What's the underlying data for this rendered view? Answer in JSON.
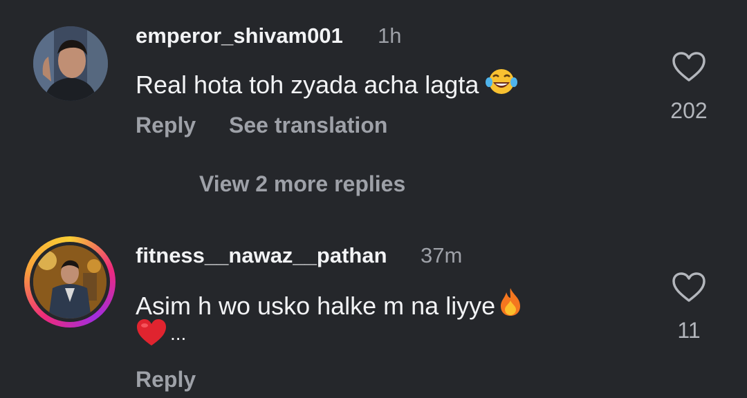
{
  "comments": [
    {
      "username": "emperor_shivam001",
      "time": "1h",
      "text": "Real hota toh zyada acha lagta",
      "emoji": "laughing-tears-emoji",
      "likes": "202",
      "actions": {
        "reply": "Reply",
        "translate": "See translation"
      },
      "view_replies": "View 2 more replies"
    },
    {
      "username": "fitness__nawaz__pathan",
      "time": "37m",
      "text_line1": "Asim h wo usko halke m na liyye",
      "text_line2_more": "...",
      "emojis": [
        "fire-emoji",
        "red-heart-emoji"
      ],
      "likes": "11",
      "actions": {
        "reply": "Reply"
      },
      "has_story_ring": true
    }
  ],
  "colors": {
    "background": "#25272b",
    "primary_text": "#f2f3f5",
    "secondary_text": "#9ea1a8",
    "story_ring": [
      "#f9ce34",
      "#ee2a7b",
      "#a12de0"
    ]
  }
}
